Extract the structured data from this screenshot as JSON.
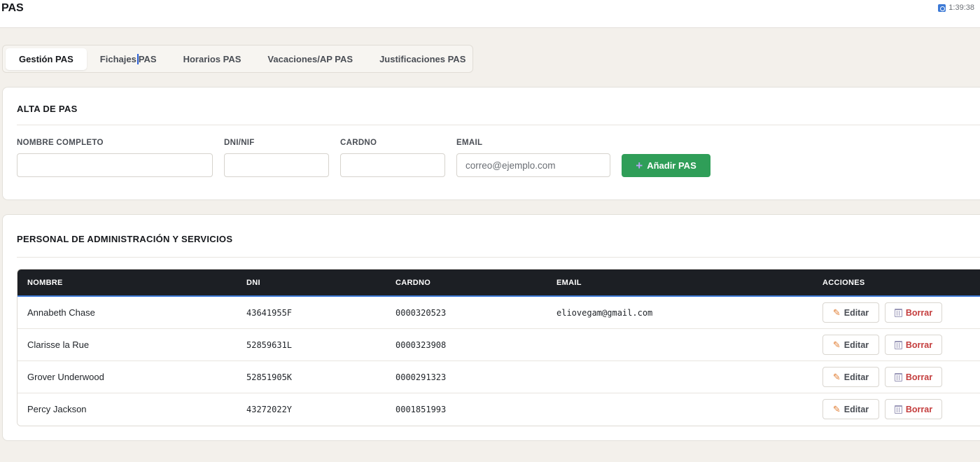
{
  "header": {
    "title": "PAS",
    "clock": "1:39:38"
  },
  "tabs": [
    {
      "label": "Gestión PAS",
      "active": true
    },
    {
      "label_a": "Fichajes",
      "label_b": "PAS"
    },
    {
      "label": "Horarios PAS"
    },
    {
      "label": "Vacaciones/AP PAS"
    },
    {
      "label": "Justificaciones PAS"
    }
  ],
  "alta": {
    "title": "ALTA DE PAS",
    "fields": {
      "nombre": {
        "label": "NOMBRE COMPLETO",
        "value": "",
        "placeholder": ""
      },
      "dni": {
        "label": "DNI/NIF",
        "value": "",
        "placeholder": ""
      },
      "cardno": {
        "label": "CARDNO",
        "value": "",
        "placeholder": ""
      },
      "email": {
        "label": "EMAIL",
        "value": "",
        "placeholder": "correo@ejemplo.com"
      }
    },
    "add_label": "Añadir PAS",
    "accent": "#2f9e58"
  },
  "list": {
    "title": "PERSONAL DE ADMINISTRACIÓN Y SERVICIOS",
    "columns": [
      "NOMBRE",
      "DNI",
      "CARDNO",
      "EMAIL",
      "ACCIONES"
    ],
    "rows": [
      {
        "nombre": "Annabeth Chase",
        "dni": "43641955F",
        "cardno": "0000320523",
        "email": "eliovegam@gmail.com"
      },
      {
        "nombre": "Clarisse la Rue",
        "dni": "52859631L",
        "cardno": "0000323908",
        "email": ""
      },
      {
        "nombre": "Grover Underwood",
        "dni": "52851905K",
        "cardno": "0000291323",
        "email": ""
      },
      {
        "nombre": "Percy Jackson",
        "dni": "43272022Y",
        "cardno": "0001851993",
        "email": ""
      }
    ],
    "edit_label": "Editar",
    "delete_label": "Borrar",
    "header_bg": "#1c1f24",
    "delete_color": "#c43d3d"
  }
}
